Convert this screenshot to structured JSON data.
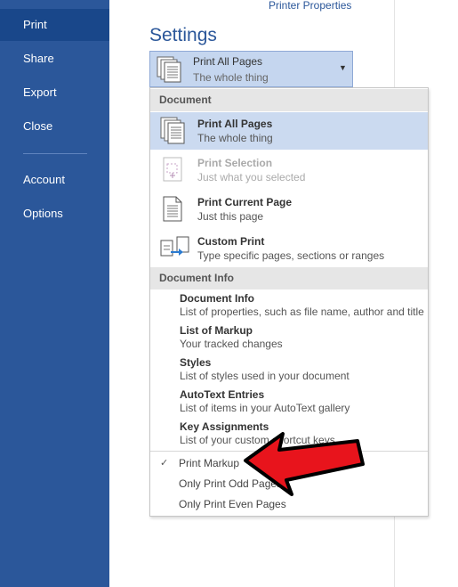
{
  "sidebar": {
    "items": [
      {
        "label": "Print"
      },
      {
        "label": "Share"
      },
      {
        "label": "Export"
      },
      {
        "label": "Close"
      },
      {
        "label": "Account"
      },
      {
        "label": "Options"
      }
    ]
  },
  "printer_properties_label": "Printer Properties",
  "settings_title": "Settings",
  "dropdown": {
    "title": "Print All Pages",
    "subtitle": "The whole thing",
    "arrow_icon": "chevron-down-icon"
  },
  "menu": {
    "sections": [
      {
        "header": "Document",
        "options": [
          {
            "title": "Print All Pages",
            "subtitle": "The whole thing",
            "icon": "all-pages-icon",
            "selected": true
          },
          {
            "title": "Print Selection",
            "subtitle": "Just what you selected",
            "icon": "selection-icon",
            "disabled": true
          },
          {
            "title": "Print Current Page",
            "subtitle": "Just this page",
            "icon": "current-page-icon"
          },
          {
            "title": "Custom Print",
            "subtitle": "Type specific pages, sections or ranges",
            "icon": "custom-print-icon"
          }
        ]
      },
      {
        "header": "Document Info",
        "items": [
          {
            "title": "Document Info",
            "subtitle": "List of properties, such as file name, author and title"
          },
          {
            "title": "List of Markup",
            "subtitle": "Your tracked changes"
          },
          {
            "title": "Styles",
            "subtitle": "List of styles used in your document"
          },
          {
            "title": "AutoText Entries",
            "subtitle": "List of items in your AutoText gallery"
          },
          {
            "title": "Key Assignments",
            "subtitle": "List of your custom shortcut keys"
          }
        ]
      }
    ],
    "toggles": [
      {
        "label": "Print Markup",
        "checked": true,
        "check_glyph": "✓"
      },
      {
        "label": "Only Print Odd Pages",
        "checked": false
      },
      {
        "label": "Only Print Even Pages",
        "checked": false
      }
    ]
  },
  "colors": {
    "sidebar": "#2b579a",
    "sidebar_active": "#19478a",
    "accent": "#2b579a",
    "selected_row": "#cbdaf0",
    "annotation_arrow": "#e8141c"
  }
}
